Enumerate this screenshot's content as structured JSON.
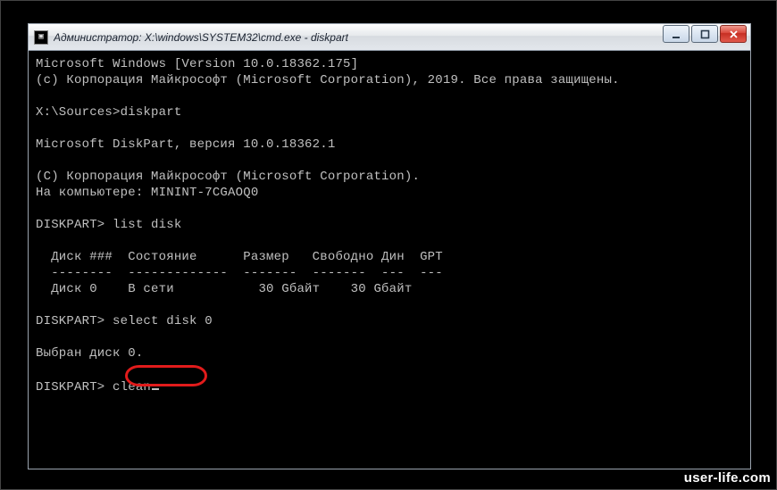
{
  "window": {
    "title": "Администратор: X:\\windows\\SYSTEM32\\cmd.exe - diskpart"
  },
  "terminal": {
    "line_version": "Microsoft Windows [Version 10.0.18362.175]",
    "line_copyright1": "(c) Корпорация Майкрософт (Microsoft Corporation), 2019. Все права защищены.",
    "prompt1": "X:\\Sources>",
    "cmd1": "diskpart",
    "line_dp_version": "Microsoft DiskPart, версия 10.0.18362.1",
    "line_dp_copyright": "(C) Корпорация Майкрософт (Microsoft Corporation).",
    "line_computer": "На компьютере: MININT-7CGAOQ0",
    "prompt_dp": "DISKPART>",
    "cmd_list": "list disk",
    "table": {
      "header": "  Диск ###  Состояние      Размер   Свободно Дин  GPT",
      "sep": "  --------  -------------  -------  -------  ---  ---",
      "row0": "  Диск 0    В сети           30 Gбайт    30 Gбайт"
    },
    "cmd_select": "select disk 0",
    "line_selected": "Выбран диск 0.",
    "cmd_clean": "clean"
  },
  "watermark": "user-life.com"
}
